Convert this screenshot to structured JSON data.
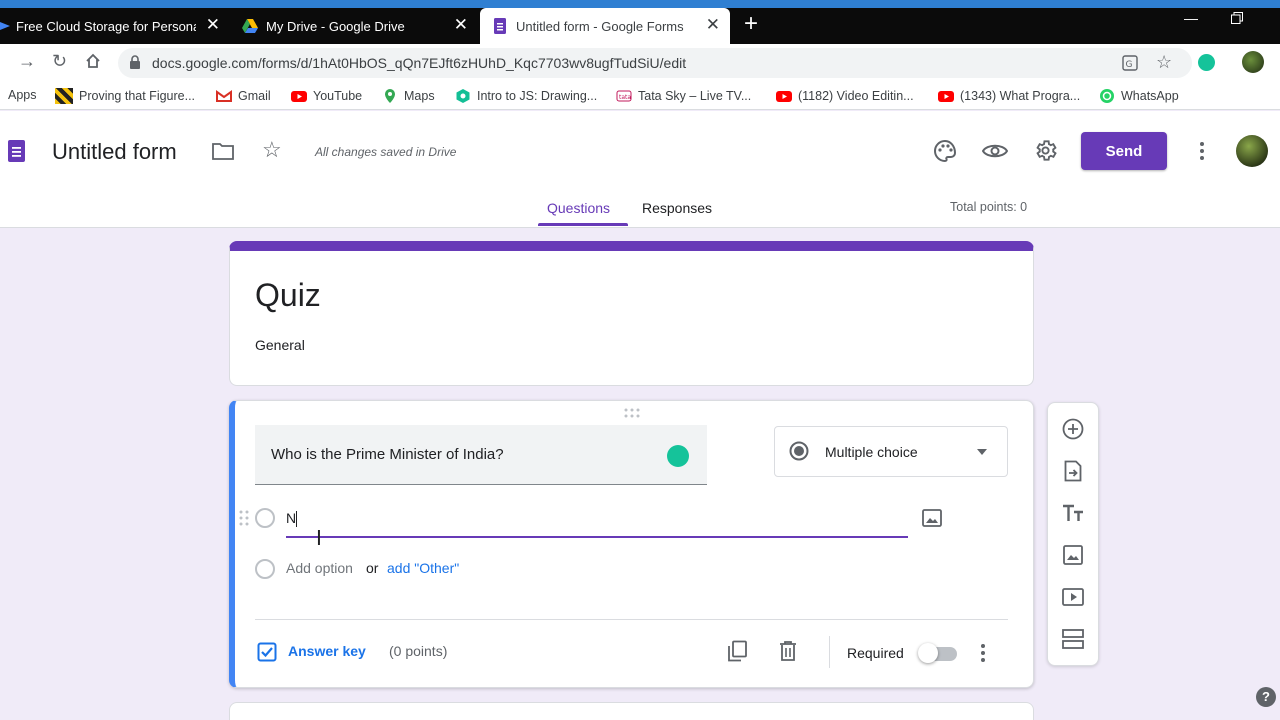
{
  "browser": {
    "tabs": [
      {
        "title": "Free Cloud Storage for Personal U"
      },
      {
        "title": "My Drive - Google Drive"
      },
      {
        "title": "Untitled form - Google Forms"
      }
    ],
    "url": "docs.google.com/forms/d/1hAt0HbOS_qQn7EJft6zHUhD_Kqc7703wv8ugfTudSiU/edit",
    "bookmarks": [
      {
        "label": "Apps"
      },
      {
        "label": "Proving that Figure..."
      },
      {
        "label": "Gmail"
      },
      {
        "label": "YouTube"
      },
      {
        "label": "Maps"
      },
      {
        "label": "Intro to JS: Drawing..."
      },
      {
        "label": "Tata Sky – Live TV..."
      },
      {
        "label": "(1182) Video Editin..."
      },
      {
        "label": "(1343) What Progra..."
      },
      {
        "label": "WhatsApp"
      }
    ]
  },
  "header": {
    "title": "Untitled form",
    "save_status": "All changes saved in Drive",
    "send_label": "Send",
    "tabs": [
      {
        "label": "Questions"
      },
      {
        "label": "Responses"
      }
    ],
    "total_points": "Total points: 0"
  },
  "form": {
    "title": "Quiz",
    "description": "General"
  },
  "question": {
    "text": "Who is the Prime Minister of India?",
    "type": "Multiple choice",
    "options": [
      {
        "value": "N"
      }
    ],
    "add_option": "Add option",
    "or": "or",
    "add_other": "add \"Other\"",
    "answer_key": "Answer key",
    "points": "(0 points)",
    "required_label": "Required",
    "required": false
  },
  "colors": {
    "accent": "#673ab7",
    "background": "#f0ebf8",
    "link": "#1a73e8",
    "question_bar": "#4285f4"
  }
}
